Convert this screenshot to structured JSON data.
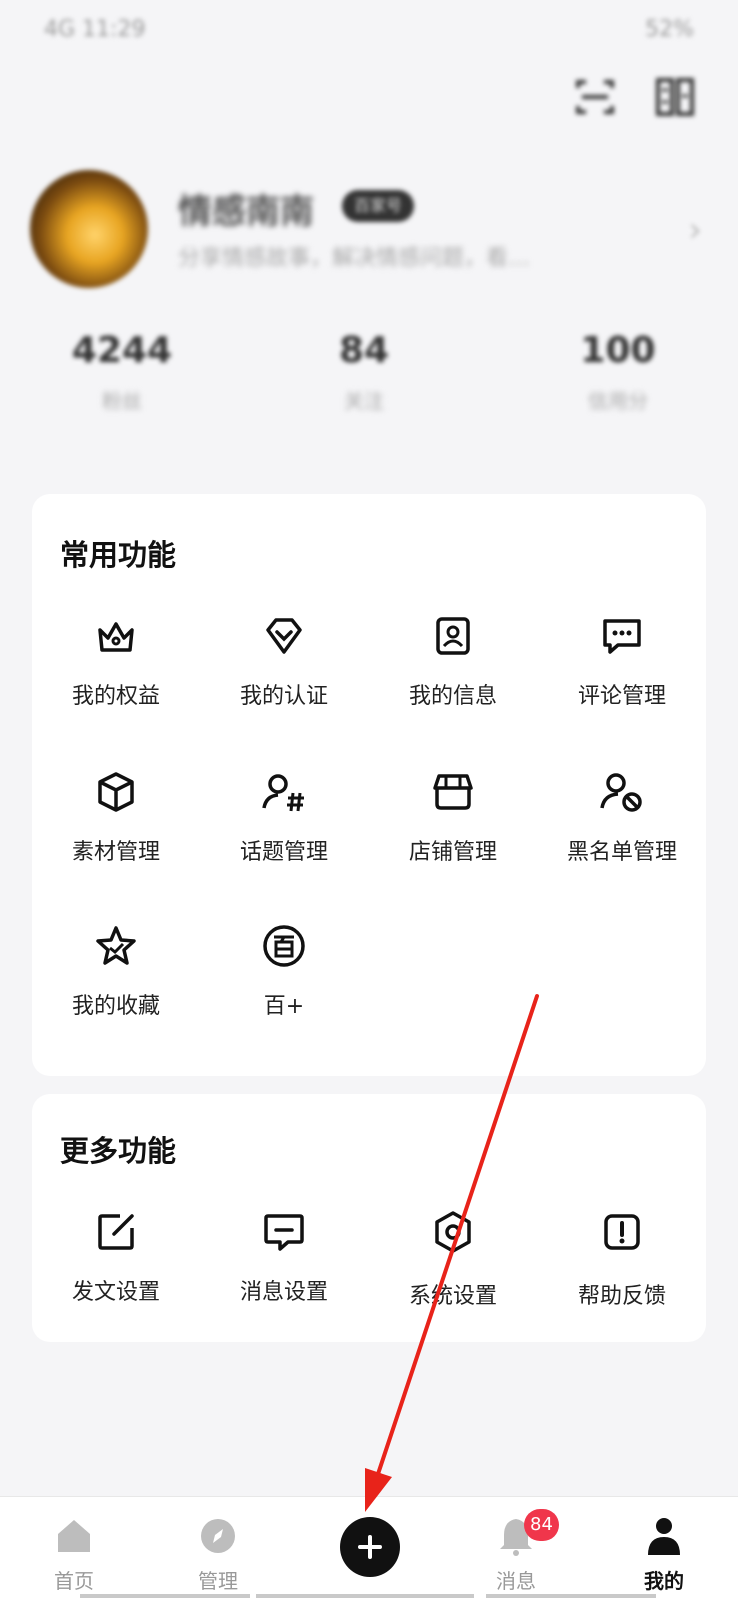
{
  "status_bar": {
    "left": "4G 11:29",
    "right": "52%"
  },
  "profile": {
    "name": "情感南南",
    "badge": "百家号",
    "bio": "分享情感故事，解决情感问题，看…"
  },
  "stats": [
    {
      "value": "4244",
      "label": "粉丝"
    },
    {
      "value": "84",
      "label": "关注"
    },
    {
      "value": "100",
      "label": "信用分"
    }
  ],
  "common": {
    "title": "常用功能",
    "items": [
      {
        "label": "我的权益",
        "icon": "crown-icon"
      },
      {
        "label": "我的认证",
        "icon": "verified-v-icon"
      },
      {
        "label": "我的信息",
        "icon": "profile-card-icon"
      },
      {
        "label": "评论管理",
        "icon": "comment-bubble-icon"
      },
      {
        "label": "素材管理",
        "icon": "cube-icon"
      },
      {
        "label": "话题管理",
        "icon": "topic-hash-icon"
      },
      {
        "label": "店铺管理",
        "icon": "store-icon"
      },
      {
        "label": "黑名单管理",
        "icon": "user-block-icon"
      },
      {
        "label": "我的收藏",
        "icon": "star-icon"
      },
      {
        "label": "百+",
        "icon": "bai-plus-icon"
      }
    ]
  },
  "more": {
    "title": "更多功能",
    "items": [
      {
        "label": "发文设置",
        "icon": "edit-icon"
      },
      {
        "label": "消息设置",
        "icon": "message-icon"
      },
      {
        "label": "系统设置",
        "icon": "settings-hex-icon"
      },
      {
        "label": "帮助反馈",
        "icon": "help-alert-icon"
      }
    ]
  },
  "tabbar": {
    "home": "首页",
    "manage": "管理",
    "messages": "消息",
    "messages_badge": "84",
    "me": "我的"
  },
  "colors": {
    "accent_black": "#111111",
    "badge_red": "#f0364b",
    "annotation_arrow": "#e8231a"
  }
}
